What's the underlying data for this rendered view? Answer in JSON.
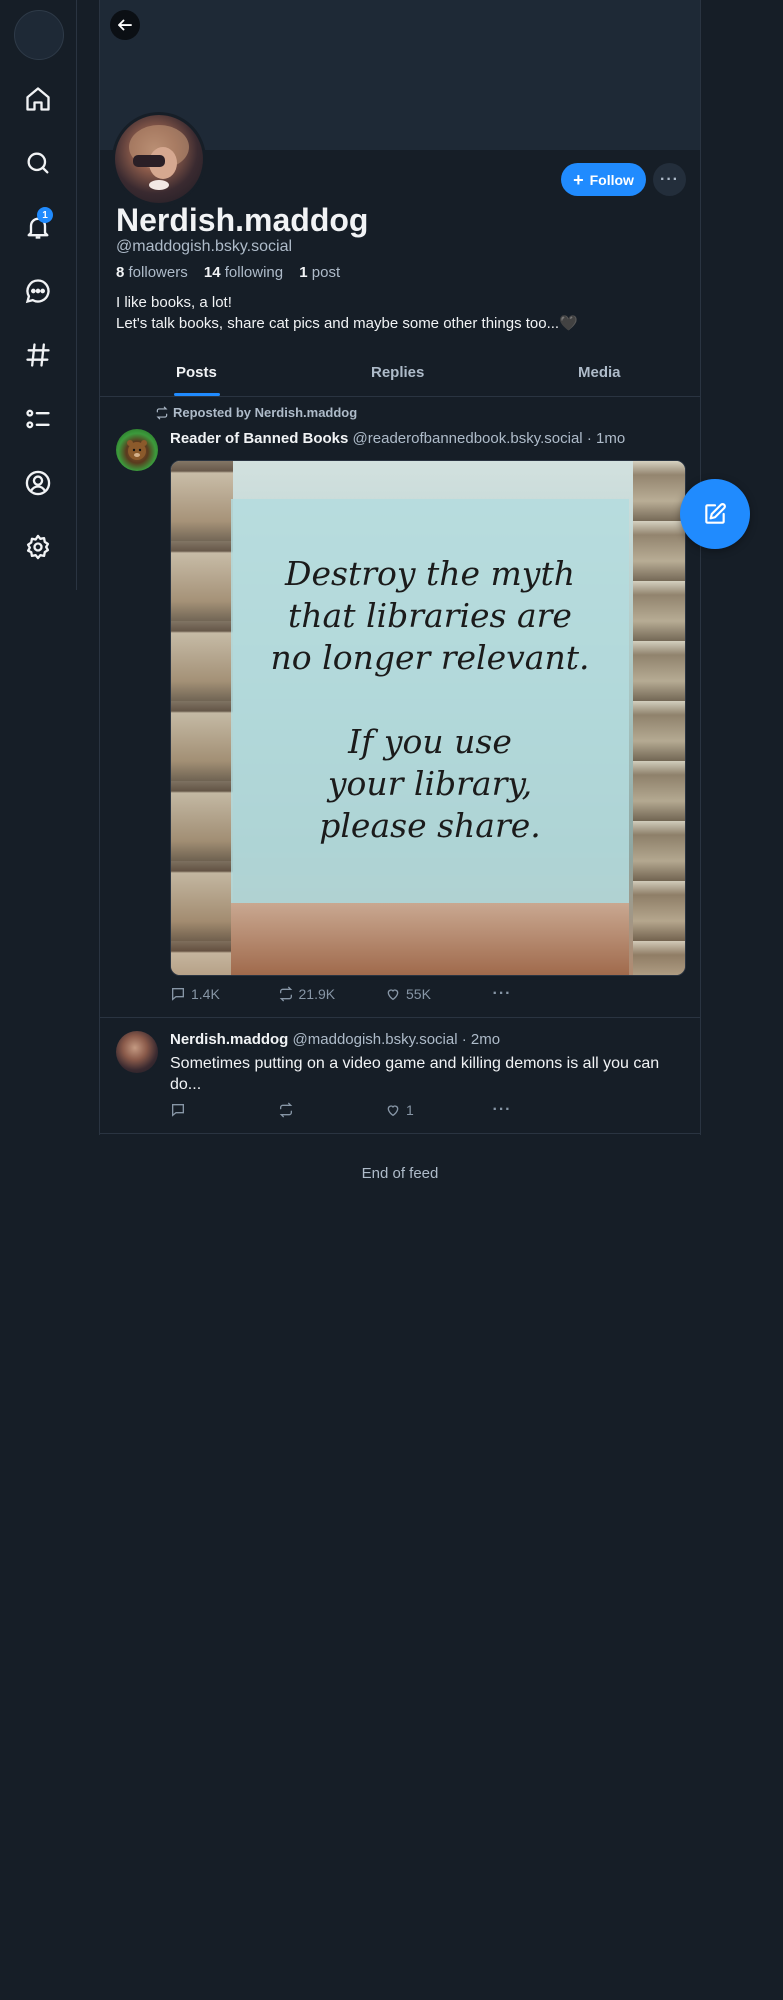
{
  "sidebar": {
    "items": [
      {
        "icon": "home-icon"
      },
      {
        "icon": "search-icon"
      },
      {
        "icon": "bell-icon",
        "badge": "1"
      },
      {
        "icon": "chat-icon"
      },
      {
        "icon": "hashtag-icon"
      },
      {
        "icon": "list-icon"
      },
      {
        "icon": "profile-icon"
      },
      {
        "icon": "gear-icon"
      }
    ]
  },
  "profile": {
    "display_name": "Nerdish.maddog",
    "handle": "@maddogish.bsky.social",
    "followers_count": "8",
    "followers_label": "followers",
    "following_count": "14",
    "following_label": "following",
    "posts_count": "1",
    "posts_label": "post",
    "bio": "I like books, a lot!\nLet's talk books, share cat pics and maybe some other things too...🖤",
    "follow_label": "Follow",
    "more_label": "···"
  },
  "tabs": [
    {
      "label": "Posts",
      "active": true
    },
    {
      "label": "Replies",
      "active": false
    },
    {
      "label": "Media",
      "active": false
    }
  ],
  "posts": [
    {
      "repost_label": "Reposted by Nerdish.maddog",
      "author": "Reader of Banned Books",
      "handle": "@readerofbannedbook.bsky.social",
      "time": "· 1mo",
      "image_text": "Destroy the myth\nthat libraries are\nno longer relevant.\n\nIf you use\nyour library,\nplease share.",
      "replies": "1.4K",
      "reposts": "21.9K",
      "likes": "55K"
    },
    {
      "author": "Nerdish.maddog",
      "handle": "@maddogish.bsky.social",
      "time": "· 2mo",
      "text": "Sometimes putting on a video game and killing demons is all you can do...",
      "replies": "",
      "reposts": "",
      "likes": "1"
    }
  ],
  "end_of_feed": "End of feed",
  "colors": {
    "accent": "#208bfe",
    "background": "#161e27",
    "border": "#2a3441",
    "muted": "#aebbc9"
  }
}
